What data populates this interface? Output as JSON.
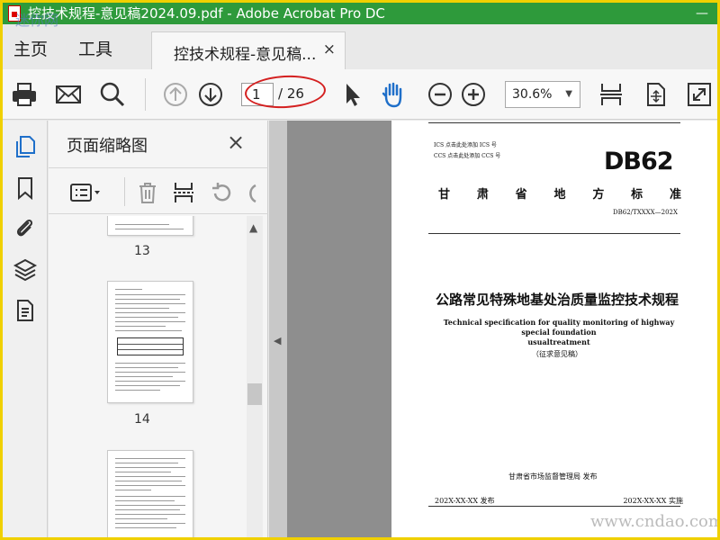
{
  "window": {
    "title": "控技术规程-意见稿2024.09.pdf - Adobe Acrobat Pro DC",
    "minimize": "—",
    "close": "✕"
  },
  "menubar": {
    "home": "主页",
    "tools": "工具",
    "doc_tab": "控技术规程-意见稿...",
    "doc_tab_close": "×"
  },
  "toolbar": {
    "current_page": "1",
    "total_pages": "/ 26",
    "zoom": "30.6%",
    "zoom_arrow": "▼"
  },
  "thumb_panel": {
    "title": "页面缩略图",
    "close": "×",
    "pages": [
      "13",
      "14"
    ]
  },
  "document": {
    "ics_line": "ICS   点击此处添加 ICS 号",
    "ccs_line": "CCS   点击此处添加 CCS 号",
    "standard_code": "DB62",
    "standard_name_chars": [
      "甘",
      "肃",
      "省",
      "地",
      "方",
      "标",
      "准"
    ],
    "standard_number": "DB62/TXXXX—202X",
    "title_cn": "公路常见特殊地基处治质量监控技术规程",
    "title_en_line1": "Technical specification for quality monitoring of highway special foundation",
    "title_en_line2": "usualtreatment",
    "draft_label": "（征求意见稿）",
    "issuer": "甘肃省市场监督管理局    发布",
    "issue_date": "202X-XX-XX 发布",
    "impl_date": "202X-XX-XX 实施"
  },
  "watermarks": {
    "top_left": "迷你网",
    "bottom_right": "www.cndao.com"
  }
}
